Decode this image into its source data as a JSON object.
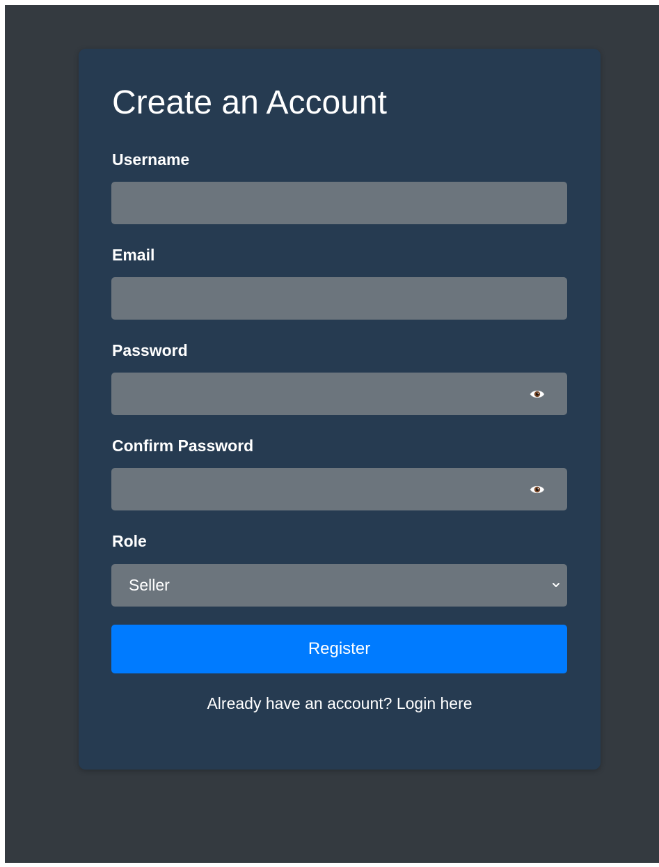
{
  "form": {
    "title": "Create an Account",
    "fields": {
      "username": {
        "label": "Username",
        "value": ""
      },
      "email": {
        "label": "Email",
        "value": ""
      },
      "password": {
        "label": "Password",
        "value": "",
        "toggle_icon": "eye-icon"
      },
      "confirm_password": {
        "label": "Confirm Password",
        "value": "",
        "toggle_icon": "eye-icon"
      },
      "role": {
        "label": "Role",
        "selected": "Seller",
        "icon": "chevron-down-icon"
      }
    },
    "register_label": "Register",
    "login_prompt": "Already have an account?",
    "login_link": "Login here"
  },
  "colors": {
    "page_background": "#343a40",
    "card_background": "#263b51",
    "input_background": "#6c757d",
    "button_primary": "#007bff",
    "text": "#ffffff"
  }
}
